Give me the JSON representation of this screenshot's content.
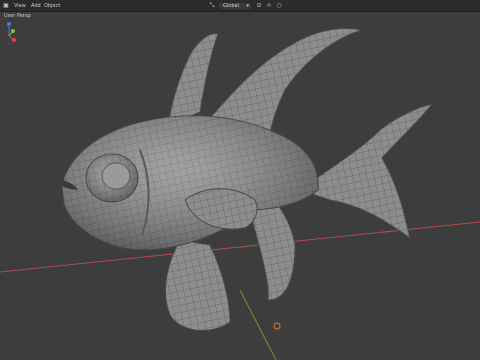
{
  "header": {
    "menus": [
      "View",
      "Add",
      "Object"
    ],
    "center_dropdown": "Global",
    "viewport_label": "User Persp"
  },
  "icons": {
    "editor_type": "cube-icon",
    "transform_orientation": "axes-icon",
    "pivot": "pivot-icon",
    "snap": "magnet-icon",
    "proportional": "circle-icon"
  },
  "colors": {
    "background": "#3d3d3d",
    "header": "#2b2b2b",
    "mesh_fill": "#8c8c8c",
    "wire": "#5c5c5c",
    "axis_x": "#c0504d",
    "axis_y": "#6a9a2a",
    "gizmo_x": "#e0404a",
    "gizmo_y": "#7fbf3f",
    "gizmo_z": "#3f7fe0"
  }
}
